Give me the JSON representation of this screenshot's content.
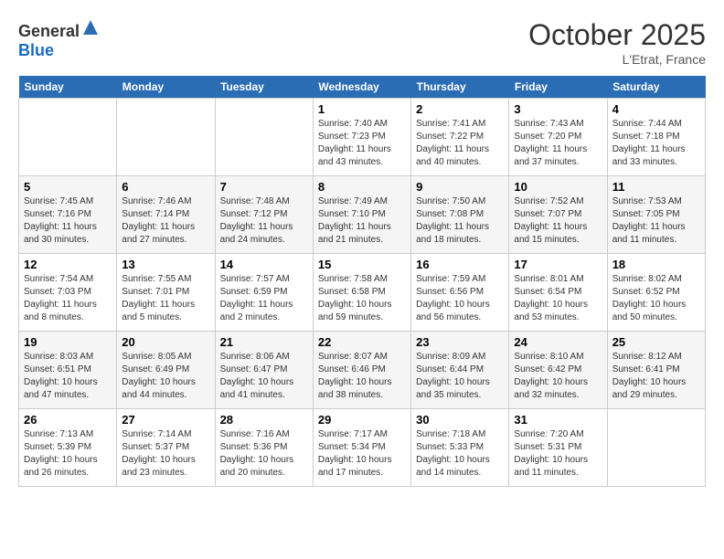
{
  "header": {
    "logo_general": "General",
    "logo_blue": "Blue",
    "month": "October 2025",
    "location": "L'Etrat, France"
  },
  "days_of_week": [
    "Sunday",
    "Monday",
    "Tuesday",
    "Wednesday",
    "Thursday",
    "Friday",
    "Saturday"
  ],
  "weeks": [
    [
      {
        "day": "",
        "info": ""
      },
      {
        "day": "",
        "info": ""
      },
      {
        "day": "",
        "info": ""
      },
      {
        "day": "1",
        "info": "Sunrise: 7:40 AM\nSunset: 7:23 PM\nDaylight: 11 hours\nand 43 minutes."
      },
      {
        "day": "2",
        "info": "Sunrise: 7:41 AM\nSunset: 7:22 PM\nDaylight: 11 hours\nand 40 minutes."
      },
      {
        "day": "3",
        "info": "Sunrise: 7:43 AM\nSunset: 7:20 PM\nDaylight: 11 hours\nand 37 minutes."
      },
      {
        "day": "4",
        "info": "Sunrise: 7:44 AM\nSunset: 7:18 PM\nDaylight: 11 hours\nand 33 minutes."
      }
    ],
    [
      {
        "day": "5",
        "info": "Sunrise: 7:45 AM\nSunset: 7:16 PM\nDaylight: 11 hours\nand 30 minutes."
      },
      {
        "day": "6",
        "info": "Sunrise: 7:46 AM\nSunset: 7:14 PM\nDaylight: 11 hours\nand 27 minutes."
      },
      {
        "day": "7",
        "info": "Sunrise: 7:48 AM\nSunset: 7:12 PM\nDaylight: 11 hours\nand 24 minutes."
      },
      {
        "day": "8",
        "info": "Sunrise: 7:49 AM\nSunset: 7:10 PM\nDaylight: 11 hours\nand 21 minutes."
      },
      {
        "day": "9",
        "info": "Sunrise: 7:50 AM\nSunset: 7:08 PM\nDaylight: 11 hours\nand 18 minutes."
      },
      {
        "day": "10",
        "info": "Sunrise: 7:52 AM\nSunset: 7:07 PM\nDaylight: 11 hours\nand 15 minutes."
      },
      {
        "day": "11",
        "info": "Sunrise: 7:53 AM\nSunset: 7:05 PM\nDaylight: 11 hours\nand 11 minutes."
      }
    ],
    [
      {
        "day": "12",
        "info": "Sunrise: 7:54 AM\nSunset: 7:03 PM\nDaylight: 11 hours\nand 8 minutes."
      },
      {
        "day": "13",
        "info": "Sunrise: 7:55 AM\nSunset: 7:01 PM\nDaylight: 11 hours\nand 5 minutes."
      },
      {
        "day": "14",
        "info": "Sunrise: 7:57 AM\nSunset: 6:59 PM\nDaylight: 11 hours\nand 2 minutes."
      },
      {
        "day": "15",
        "info": "Sunrise: 7:58 AM\nSunset: 6:58 PM\nDaylight: 10 hours\nand 59 minutes."
      },
      {
        "day": "16",
        "info": "Sunrise: 7:59 AM\nSunset: 6:56 PM\nDaylight: 10 hours\nand 56 minutes."
      },
      {
        "day": "17",
        "info": "Sunrise: 8:01 AM\nSunset: 6:54 PM\nDaylight: 10 hours\nand 53 minutes."
      },
      {
        "day": "18",
        "info": "Sunrise: 8:02 AM\nSunset: 6:52 PM\nDaylight: 10 hours\nand 50 minutes."
      }
    ],
    [
      {
        "day": "19",
        "info": "Sunrise: 8:03 AM\nSunset: 6:51 PM\nDaylight: 10 hours\nand 47 minutes."
      },
      {
        "day": "20",
        "info": "Sunrise: 8:05 AM\nSunset: 6:49 PM\nDaylight: 10 hours\nand 44 minutes."
      },
      {
        "day": "21",
        "info": "Sunrise: 8:06 AM\nSunset: 6:47 PM\nDaylight: 10 hours\nand 41 minutes."
      },
      {
        "day": "22",
        "info": "Sunrise: 8:07 AM\nSunset: 6:46 PM\nDaylight: 10 hours\nand 38 minutes."
      },
      {
        "day": "23",
        "info": "Sunrise: 8:09 AM\nSunset: 6:44 PM\nDaylight: 10 hours\nand 35 minutes."
      },
      {
        "day": "24",
        "info": "Sunrise: 8:10 AM\nSunset: 6:42 PM\nDaylight: 10 hours\nand 32 minutes."
      },
      {
        "day": "25",
        "info": "Sunrise: 8:12 AM\nSunset: 6:41 PM\nDaylight: 10 hours\nand 29 minutes."
      }
    ],
    [
      {
        "day": "26",
        "info": "Sunrise: 7:13 AM\nSunset: 5:39 PM\nDaylight: 10 hours\nand 26 minutes."
      },
      {
        "day": "27",
        "info": "Sunrise: 7:14 AM\nSunset: 5:37 PM\nDaylight: 10 hours\nand 23 minutes."
      },
      {
        "day": "28",
        "info": "Sunrise: 7:16 AM\nSunset: 5:36 PM\nDaylight: 10 hours\nand 20 minutes."
      },
      {
        "day": "29",
        "info": "Sunrise: 7:17 AM\nSunset: 5:34 PM\nDaylight: 10 hours\nand 17 minutes."
      },
      {
        "day": "30",
        "info": "Sunrise: 7:18 AM\nSunset: 5:33 PM\nDaylight: 10 hours\nand 14 minutes."
      },
      {
        "day": "31",
        "info": "Sunrise: 7:20 AM\nSunset: 5:31 PM\nDaylight: 10 hours\nand 11 minutes."
      },
      {
        "day": "",
        "info": ""
      }
    ]
  ]
}
